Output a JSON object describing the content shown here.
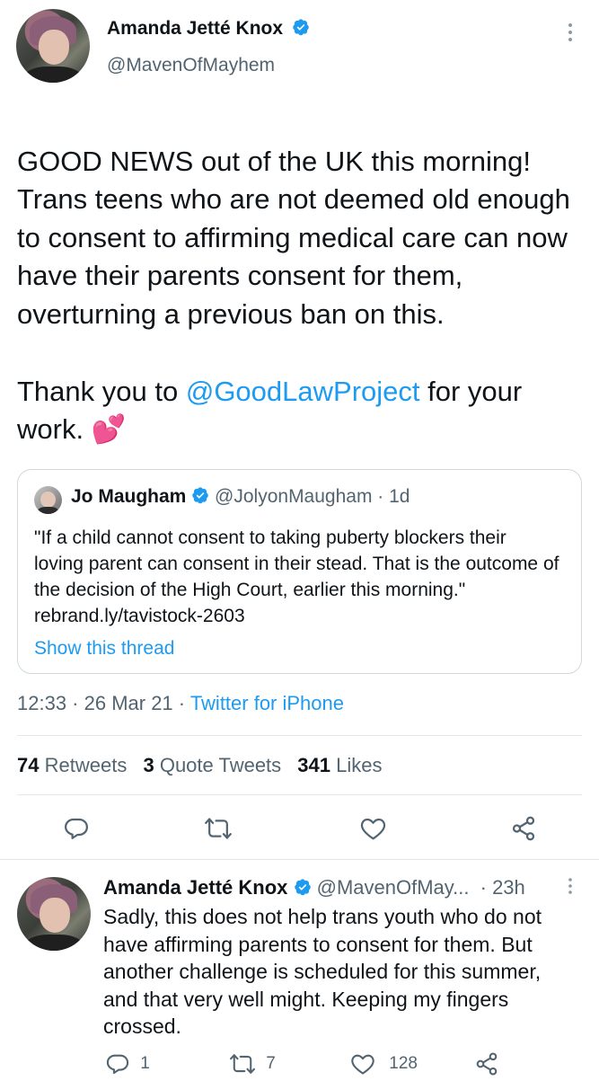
{
  "tweet": {
    "author_name": "Amanda Jetté Knox",
    "author_handle": "@MavenOfMayhem",
    "body_line_1": "GOOD NEWS out of the UK this morning! Trans teens who are not deemed old enough to consent to affirming medical care can now have their parents consent for them, overturning a previous ban on this.",
    "body_thanks_prefix": "Thank you to ",
    "body_mention": "@GoodLawProject",
    "body_thanks_suffix": " for your",
    "body_last": "work.",
    "emoji": "💕",
    "timestamp": "12:33 · 26 Mar 21 · ",
    "source": "Twitter for iPhone"
  },
  "quote": {
    "author_name": "Jo Maugham",
    "author_handle": "@JolyonMaugham",
    "age": "· 1d",
    "text": "\"If a child cannot consent to taking puberty blockers their loving parent can consent in their stead. That is the outcome of the decision of the High Court, earlier this morning.\" rebrand.ly/tavistock-2603",
    "show_thread": "Show this thread"
  },
  "stats": {
    "retweets_count": "74",
    "retweets_label": "Retweets",
    "quotes_count": "3",
    "quotes_label": "Quote Tweets",
    "likes_count": "341",
    "likes_label": "Likes"
  },
  "reply": {
    "author_name": "Amanda Jetté Knox",
    "author_handle": "@MavenOfMay...",
    "age": "· 23h",
    "text": "Sadly, this does not help trans youth who do not have affirming parents to consent for them. But another challenge is scheduled for this summer, and that very well might. Keeping my fingers crossed.",
    "reply_count": "1",
    "retweet_count": "7",
    "like_count": "128"
  },
  "colors": {
    "accent": "#1d9bf0",
    "text": "#0f1419",
    "secondary": "#536471",
    "divider": "#e1e8ed"
  },
  "icons": [
    "verified-badge-icon",
    "more-options-icon",
    "reply-icon",
    "retweet-icon",
    "like-icon",
    "share-icon"
  ]
}
